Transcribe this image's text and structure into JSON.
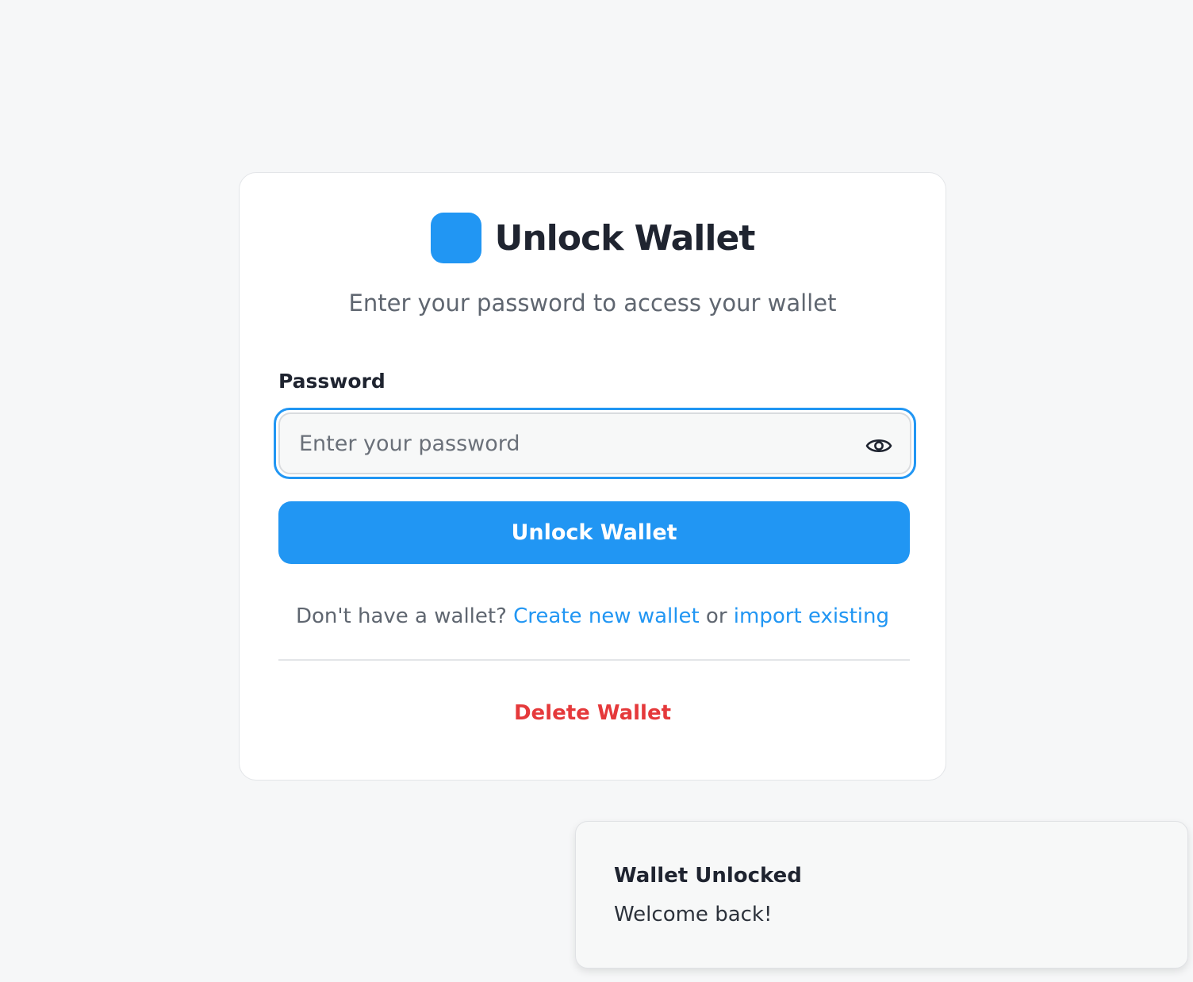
{
  "card": {
    "title": "Unlock Wallet",
    "subtitle": "Enter your password to access your wallet",
    "password_label": "Password",
    "password_placeholder": "Enter your password",
    "password_value": "",
    "unlock_button": "Unlock Wallet",
    "footer_prefix": "Don't have a wallet?",
    "create_link": "Create new wallet",
    "footer_or": "or",
    "import_link": "import existing",
    "delete_button": "Delete Wallet"
  },
  "toast": {
    "title": "Wallet Unlocked",
    "message": "Welcome back!"
  },
  "icons": {
    "logo": "wallet-logo",
    "toggle_visibility": "eye-icon"
  },
  "colors": {
    "accent": "#2196f3",
    "danger": "#e5393b",
    "background": "#f6f7f8"
  }
}
